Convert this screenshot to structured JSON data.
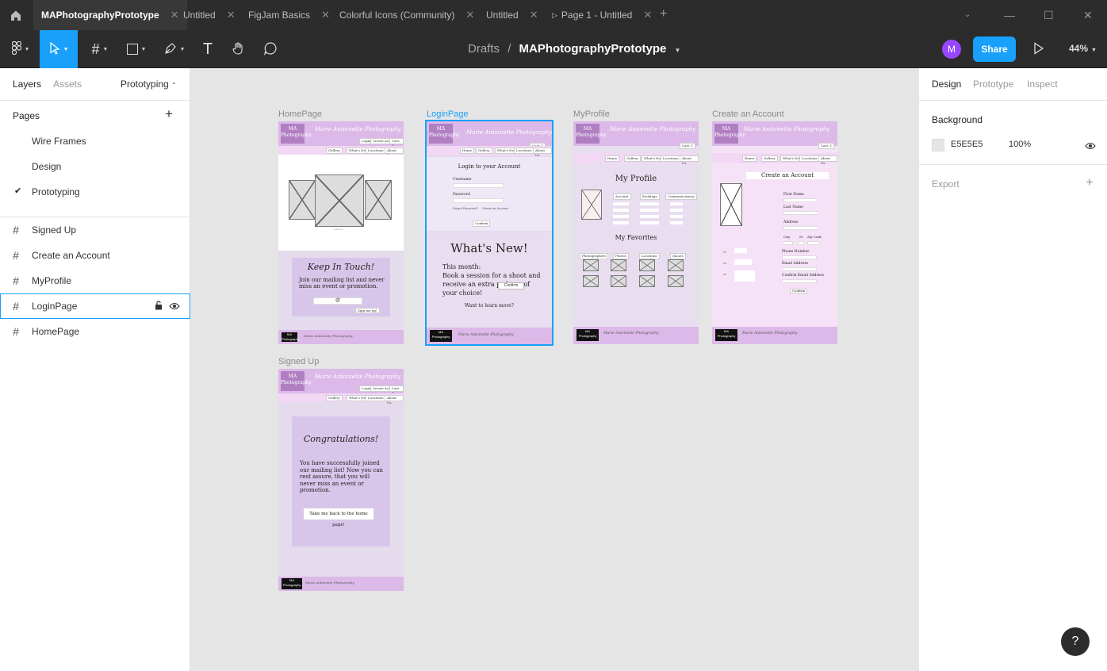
{
  "tabs": [
    {
      "label": "MAPhotographyPrototype"
    },
    {
      "label": "Untitled"
    },
    {
      "label": "FigJam Basics"
    },
    {
      "label": "Colorful Icons (Community)"
    },
    {
      "label": "Untitled"
    },
    {
      "label": "Page 1 - Untitled"
    }
  ],
  "toolbar": {
    "breadcrumb_root": "Drafts",
    "breadcrumb_sep": "/",
    "file_name": "MAPhotographyPrototype",
    "avatar": "M",
    "share": "Share",
    "zoom": "44%"
  },
  "left": {
    "tabs": [
      "Layers",
      "Assets"
    ],
    "mode": "Prototyping",
    "pages_title": "Pages",
    "pages": [
      "Wire Frames",
      "Design",
      "Prototyping"
    ],
    "layers": [
      "Signed Up",
      "Create an Account",
      "MyProfile",
      "LoginPage",
      "HomePage"
    ]
  },
  "right": {
    "tabs": [
      "Design",
      "Prototype",
      "Inspect"
    ],
    "background_title": "Background",
    "bg_hex": "E5E5E5",
    "bg_opacity": "100%",
    "export_title": "Export"
  },
  "canvas": {
    "home": {
      "label": "HomePage",
      "keep": "Keep In Touch!",
      "keep_body": "Join our mailing list and never miss an event or promotion.",
      "at": "@",
      "signup": "Sign me up!"
    },
    "login": {
      "label": "LoginPage",
      "login_title": "Login to your Account",
      "username": "Username",
      "password": "Password",
      "forgot": "Forgot Password?",
      "create": "Create an Account",
      "confirm": "Confirm",
      "whats_new": "What's New!",
      "this_month": "This month:",
      "body": "Book a session for a shoot and receive an extra p   ckage of your choice!",
      "tooltip": "Confirm",
      "learn": "Want to learn more?"
    },
    "profile": {
      "label": "MyProfile",
      "title": "My Profile",
      "cols": [
        "Account",
        "Bookings",
        "Communications"
      ],
      "favorites": "My Favorites",
      "fav_cols": [
        "Photographers",
        "Photos",
        "Locations",
        "Shoots"
      ]
    },
    "create": {
      "label": "Create an Account",
      "title": "Create an Account",
      "fields": [
        "First Name",
        "Last Name",
        "Address",
        "City",
        "St",
        "Zip Code",
        "Phone Number",
        "Email Address",
        "Confirm Email Address"
      ],
      "confirm": "Confirm"
    },
    "signed": {
      "label": "Signed Up",
      "congrats": "Congratulations!",
      "body": "You have successfully joined our mailing list! Now you can rest assure, that you will never miss an event or promotion.",
      "back": "Take me back to the home page!"
    },
    "brand": "MA Photography",
    "brand_script": "Marie Antoinette Photography",
    "nav": [
      "Gallery",
      "What's New",
      "Locations",
      "About Us"
    ],
    "nav_profile": [
      "Home",
      "Gallery",
      "What's New",
      "Locations",
      "About Us"
    ],
    "login_btn": "Login",
    "create_btn": "Create Account",
    "cart": "Cart: 1"
  },
  "help": "?"
}
